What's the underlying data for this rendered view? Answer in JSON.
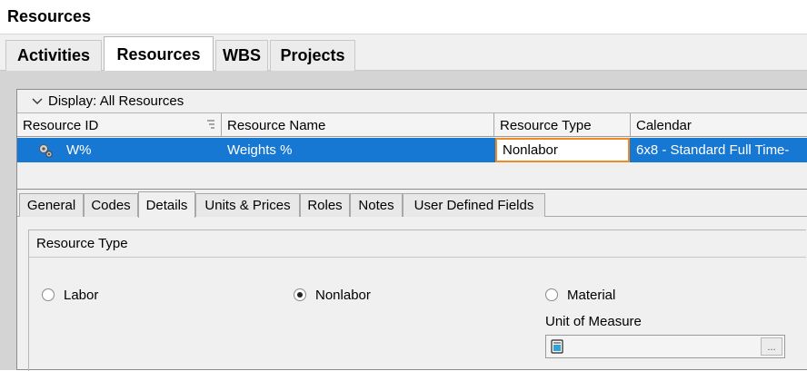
{
  "window": {
    "title": "Resources"
  },
  "main_tabs": [
    {
      "label": "Activities"
    },
    {
      "label": "Resources"
    },
    {
      "label": "WBS"
    },
    {
      "label": "Projects"
    }
  ],
  "grid": {
    "display_filter": "Display: All Resources",
    "columns": [
      "Resource ID",
      "Resource Name",
      "Resource Type",
      "Calendar"
    ],
    "rows": [
      {
        "id": "W%",
        "name": "Weights %",
        "type": "Nonlabor",
        "calendar": "6x8 - Standard Full Time-"
      }
    ]
  },
  "detail_tabs": [
    {
      "label": "General"
    },
    {
      "label": "Codes"
    },
    {
      "label": "Details"
    },
    {
      "label": "Units & Prices"
    },
    {
      "label": "Roles"
    },
    {
      "label": "Notes"
    },
    {
      "label": "User Defined Fields"
    }
  ],
  "details": {
    "group_title": "Resource Type",
    "options": [
      {
        "label": "Labor",
        "checked": false
      },
      {
        "label": "Nonlabor",
        "checked": true
      },
      {
        "label": "Material",
        "checked": false
      }
    ],
    "unit_of_measure_label": "Unit of Measure",
    "unit_of_measure_value": "",
    "browse_button": "..."
  },
  "colors": {
    "selection": "#1778d4",
    "edit_border": "#f08a24"
  }
}
